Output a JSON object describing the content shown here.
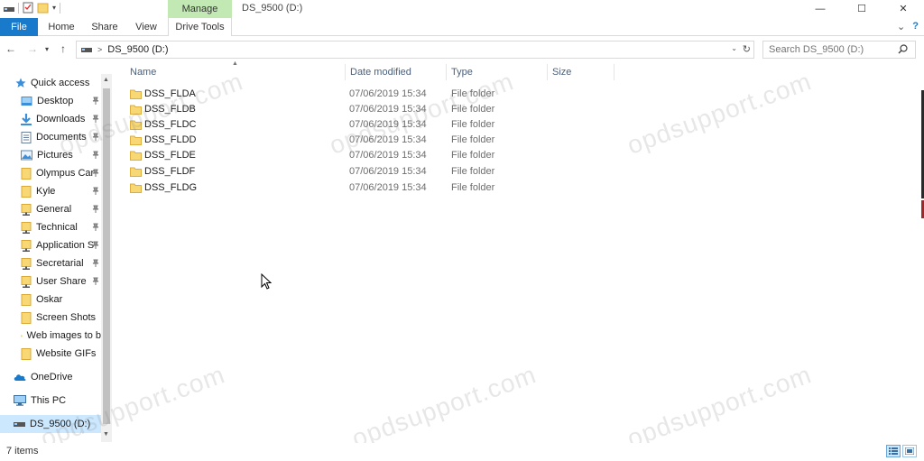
{
  "window": {
    "title": "DS_9500 (D:)",
    "contextual_tab": "Manage",
    "min_glyph": "—",
    "max_glyph": "☐",
    "close_glyph": "✕"
  },
  "ribbon": {
    "tabs": [
      {
        "label": "File",
        "active": false
      },
      {
        "label": "Home"
      },
      {
        "label": "Share"
      },
      {
        "label": "View"
      },
      {
        "label": "Drive Tools"
      }
    ],
    "collapse_glyph": "⌄",
    "help_glyph": "?"
  },
  "address": {
    "path": "DS_9500 (D:)",
    "search_placeholder": "Search DS_9500 (D:)"
  },
  "nav": {
    "items": [
      {
        "label": "Quick access",
        "icon": "star-icon",
        "pinned": false
      },
      {
        "label": "Desktop",
        "icon": "desktop-folder-icon",
        "pinned": true
      },
      {
        "label": "Downloads",
        "icon": "download-icon",
        "pinned": true
      },
      {
        "label": "Documents",
        "icon": "documents-icon",
        "pinned": true
      },
      {
        "label": "Pictures",
        "icon": "pictures-icon",
        "pinned": true
      },
      {
        "label": "Olympus Car",
        "icon": "folder-icon",
        "pinned": true
      },
      {
        "label": "Kyle",
        "icon": "folder-icon",
        "pinned": true
      },
      {
        "label": "General",
        "icon": "network-folder-icon",
        "pinned": true
      },
      {
        "label": "Technical",
        "icon": "network-folder-icon",
        "pinned": true
      },
      {
        "label": "Application S",
        "icon": "network-folder-icon",
        "pinned": true
      },
      {
        "label": "Secretarial",
        "icon": "network-folder-icon",
        "pinned": true
      },
      {
        "label": "User Share",
        "icon": "network-folder-icon",
        "pinned": true
      },
      {
        "label": "Oskar",
        "icon": "folder-icon",
        "pinned": false
      },
      {
        "label": "Screen Shots",
        "icon": "folder-icon",
        "pinned": false
      },
      {
        "label": "Web images to b",
        "icon": "folder-icon",
        "pinned": false
      },
      {
        "label": "Website GIFs",
        "icon": "folder-icon",
        "pinned": false
      },
      {
        "label": "OneDrive",
        "icon": "onedrive-icon",
        "pinned": false
      },
      {
        "label": "This PC",
        "icon": "pc-icon",
        "pinned": false
      },
      {
        "label": "DS_9500 (D:)",
        "icon": "drive-icon",
        "pinned": false
      }
    ]
  },
  "columns": {
    "name": "Name",
    "date": "Date modified",
    "type": "Type",
    "size": "Size"
  },
  "files": [
    {
      "name": "DSS_FLDA",
      "date": "07/06/2019 15:34",
      "type": "File folder"
    },
    {
      "name": "DSS_FLDB",
      "date": "07/06/2019 15:34",
      "type": "File folder"
    },
    {
      "name": "DSS_FLDC",
      "date": "07/06/2019 15:34",
      "type": "File folder"
    },
    {
      "name": "DSS_FLDD",
      "date": "07/06/2019 15:34",
      "type": "File folder"
    },
    {
      "name": "DSS_FLDE",
      "date": "07/06/2019 15:34",
      "type": "File folder"
    },
    {
      "name": "DSS_FLDF",
      "date": "07/06/2019 15:34",
      "type": "File folder"
    },
    {
      "name": "DSS_FLDG",
      "date": "07/06/2019 15:34",
      "type": "File folder"
    }
  ],
  "status": {
    "item_count": "7 items"
  },
  "watermark": "opdsupport.com",
  "colors": {
    "file_tab": "#1979ca",
    "manage_tab": "#c2e8b3",
    "selected_nav": "#cce8ff",
    "folder": "#f8d775"
  }
}
